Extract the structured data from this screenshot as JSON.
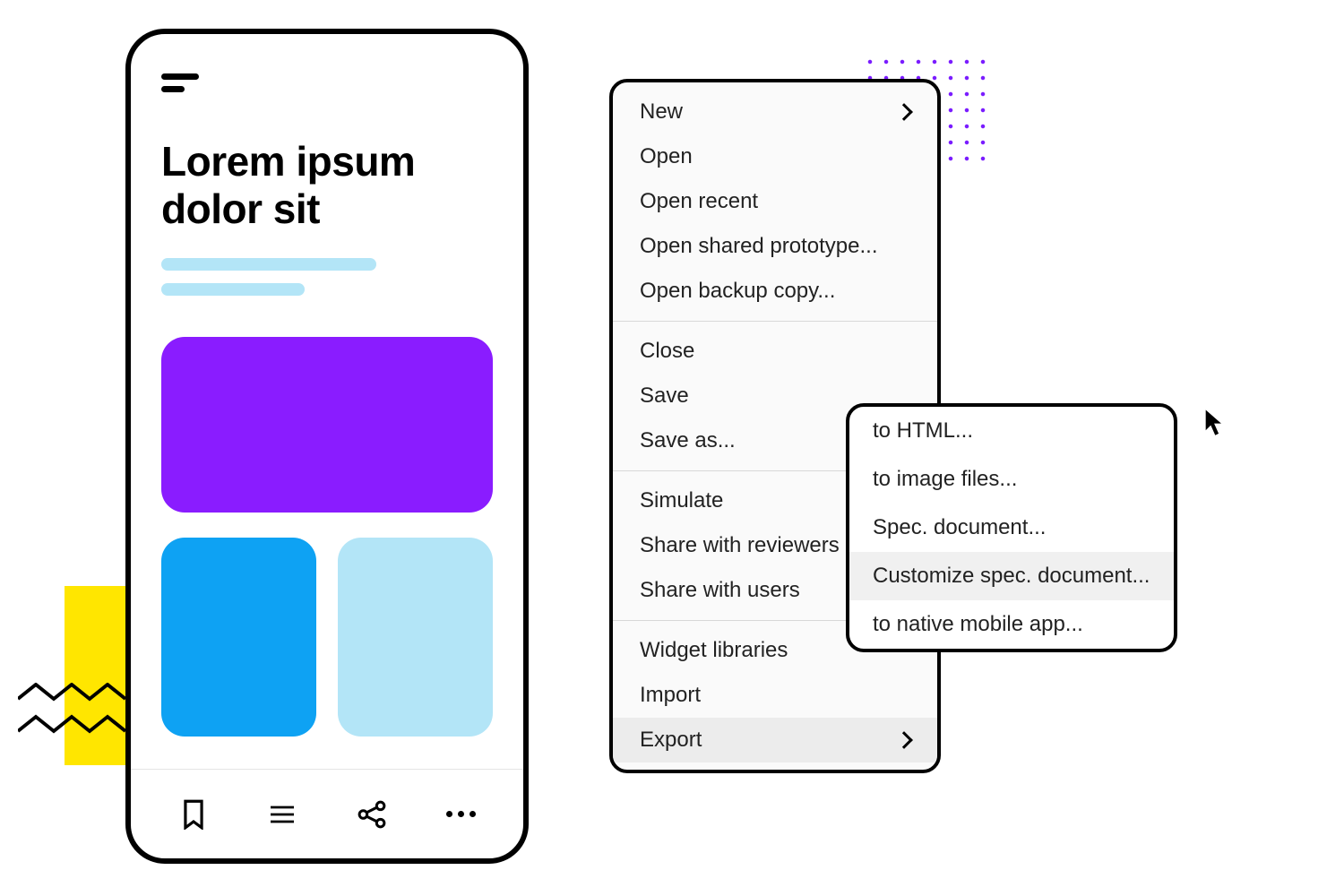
{
  "phone": {
    "title": "Lorem ipsum dolor sit",
    "tabs": {
      "bookmark": "bookmark",
      "list": "list",
      "share": "share",
      "more": "more"
    }
  },
  "decor": {
    "yellow": "#ffe600",
    "purple": "#8a1cff",
    "blue": "#0ea2f3",
    "light_blue": "#b3e5f7",
    "dot_color": "#7a1cff"
  },
  "menu": {
    "groups": [
      {
        "items": [
          {
            "label": "New",
            "submenu": true
          },
          {
            "label": "Open",
            "submenu": false
          },
          {
            "label": "Open recent",
            "submenu": false
          },
          {
            "label": "Open shared prototype...",
            "submenu": false
          },
          {
            "label": "Open backup copy...",
            "submenu": false
          }
        ]
      },
      {
        "items": [
          {
            "label": "Close",
            "submenu": false
          },
          {
            "label": "Save",
            "submenu": false
          },
          {
            "label": "Save as...",
            "submenu": false
          }
        ]
      },
      {
        "items": [
          {
            "label": "Simulate",
            "submenu": false
          },
          {
            "label": "Share with reviewers",
            "submenu": false
          },
          {
            "label": "Share with users",
            "submenu": false
          }
        ]
      },
      {
        "items": [
          {
            "label": "Widget libraries",
            "submenu": false
          },
          {
            "label": "Import",
            "submenu": false
          },
          {
            "label": "Export",
            "submenu": true,
            "highlight": true
          }
        ]
      }
    ]
  },
  "submenu": {
    "items": [
      {
        "label": "to HTML...",
        "highlight": false
      },
      {
        "label": "to image files...",
        "highlight": false
      },
      {
        "label": "Spec. document...",
        "highlight": false
      },
      {
        "label": "Customize spec. document...",
        "highlight": true
      },
      {
        "label": "to native mobile app...",
        "highlight": false
      }
    ]
  }
}
